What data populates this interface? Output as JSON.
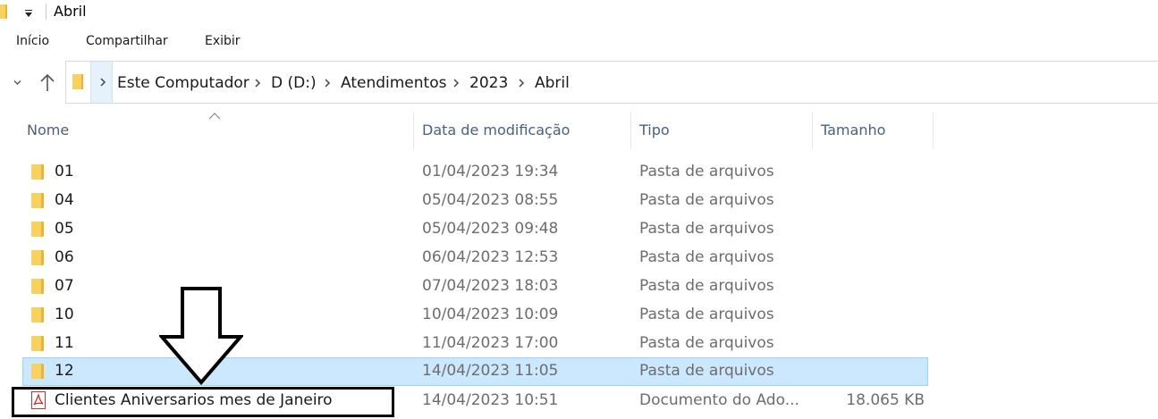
{
  "window": {
    "title": "Abril"
  },
  "ribbon": {
    "tabs": [
      {
        "label": "Início"
      },
      {
        "label": "Compartilhar"
      },
      {
        "label": "Exibir"
      }
    ]
  },
  "address": {
    "crumbs": [
      "Este Computador",
      "D (D:)",
      "Atendimentos",
      "2023",
      "Abril"
    ]
  },
  "columns": {
    "name": "Nome",
    "date": "Data de modificação",
    "type": "Tipo",
    "size": "Tamanho"
  },
  "files": [
    {
      "name": "01",
      "date": "01/04/2023 19:34",
      "type": "Pasta de arquivos",
      "size": "",
      "icon": "folder-icon",
      "selected": false
    },
    {
      "name": "04",
      "date": "05/04/2023 08:55",
      "type": "Pasta de arquivos",
      "size": "",
      "icon": "folder-icon",
      "selected": false
    },
    {
      "name": "05",
      "date": "05/04/2023 09:48",
      "type": "Pasta de arquivos",
      "size": "",
      "icon": "folder-icon",
      "selected": false
    },
    {
      "name": "06",
      "date": "06/04/2023 12:53",
      "type": "Pasta de arquivos",
      "size": "",
      "icon": "folder-icon",
      "selected": false
    },
    {
      "name": "07",
      "date": "07/04/2023 18:03",
      "type": "Pasta de arquivos",
      "size": "",
      "icon": "folder-icon",
      "selected": false
    },
    {
      "name": "10",
      "date": "10/04/2023 10:09",
      "type": "Pasta de arquivos",
      "size": "",
      "icon": "folder-icon",
      "selected": false
    },
    {
      "name": "11",
      "date": "11/04/2023 17:00",
      "type": "Pasta de arquivos",
      "size": "",
      "icon": "folder-icon",
      "selected": false
    },
    {
      "name": "12",
      "date": "14/04/2023 11:05",
      "type": "Pasta de arquivos",
      "size": "",
      "icon": "folder-icon",
      "selected": true
    },
    {
      "name": "Clientes Aniversarios mes de Janeiro",
      "date": "14/04/2023 10:51",
      "type": "Documento do Ado...",
      "size": "18.065 KB",
      "icon": "pdf-icon",
      "selected": false
    }
  ],
  "colors": {
    "selection_bg": "#cce8ff",
    "selection_border": "#99d1ff",
    "header_text": "#4c607a",
    "folder": "#f8d25c"
  }
}
